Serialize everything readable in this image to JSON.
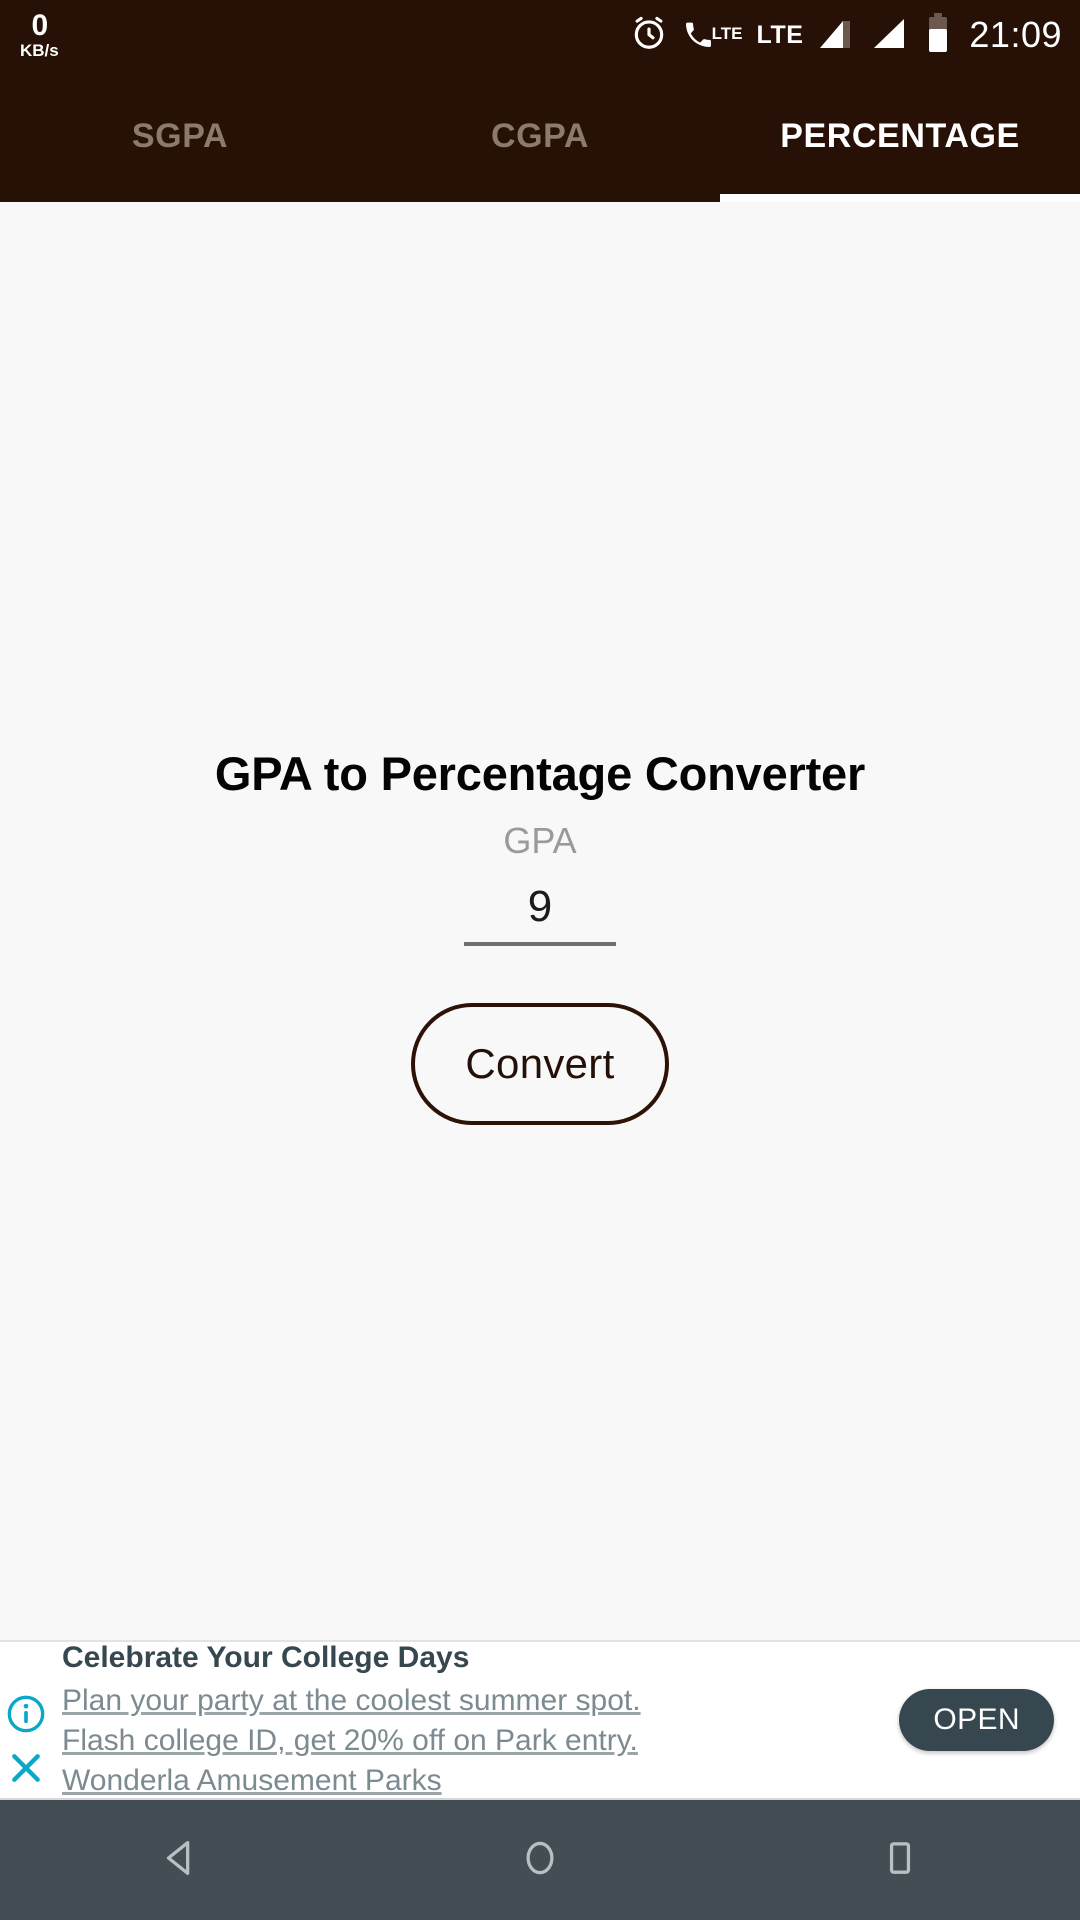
{
  "status_bar": {
    "network_speed_value": "0",
    "network_speed_unit": "KB/s",
    "alarm_icon": "alarm-clock-icon",
    "volte_icon": "volte-call-icon",
    "volte_label": "LTE",
    "lte_label": "LTE",
    "signal_1_icon": "signal-bars-sim1-icon",
    "signal_2_icon": "signal-bars-sim2-icon",
    "battery_icon": "battery-icon",
    "clock": "21:09"
  },
  "tabs": [
    {
      "label": "SGPA",
      "active": false
    },
    {
      "label": "CGPA",
      "active": false
    },
    {
      "label": "PERCENTAGE",
      "active": true
    }
  ],
  "main": {
    "title": "GPA to Percentage Converter",
    "field_label": "GPA",
    "gpa_value": "9",
    "gpa_placeholder": "",
    "convert_label": "Convert"
  },
  "ad": {
    "info_icon": "info-circle-icon",
    "close_icon": "close-x-icon",
    "title": "Celebrate Your College Days",
    "body": "Plan your party at the coolest summer spot. Flash college ID, get 20% off on Park entry. Wonderla Amusement Parks",
    "cta_label": "OPEN"
  },
  "nav_bar": {
    "back_icon": "back-triangle-icon",
    "home_icon": "home-circle-icon",
    "recents_icon": "recents-square-icon"
  },
  "colors": {
    "header_brown": "#271006",
    "body_bg": "#f8f8f8",
    "tab_inactive": "#8d7a6f",
    "tab_active": "#ffffff",
    "button_outline": "#2d1206",
    "ad_accent_cyan": "#0aa8c8",
    "ad_cta_bg": "#37474f",
    "nav_bg": "#434e54"
  }
}
